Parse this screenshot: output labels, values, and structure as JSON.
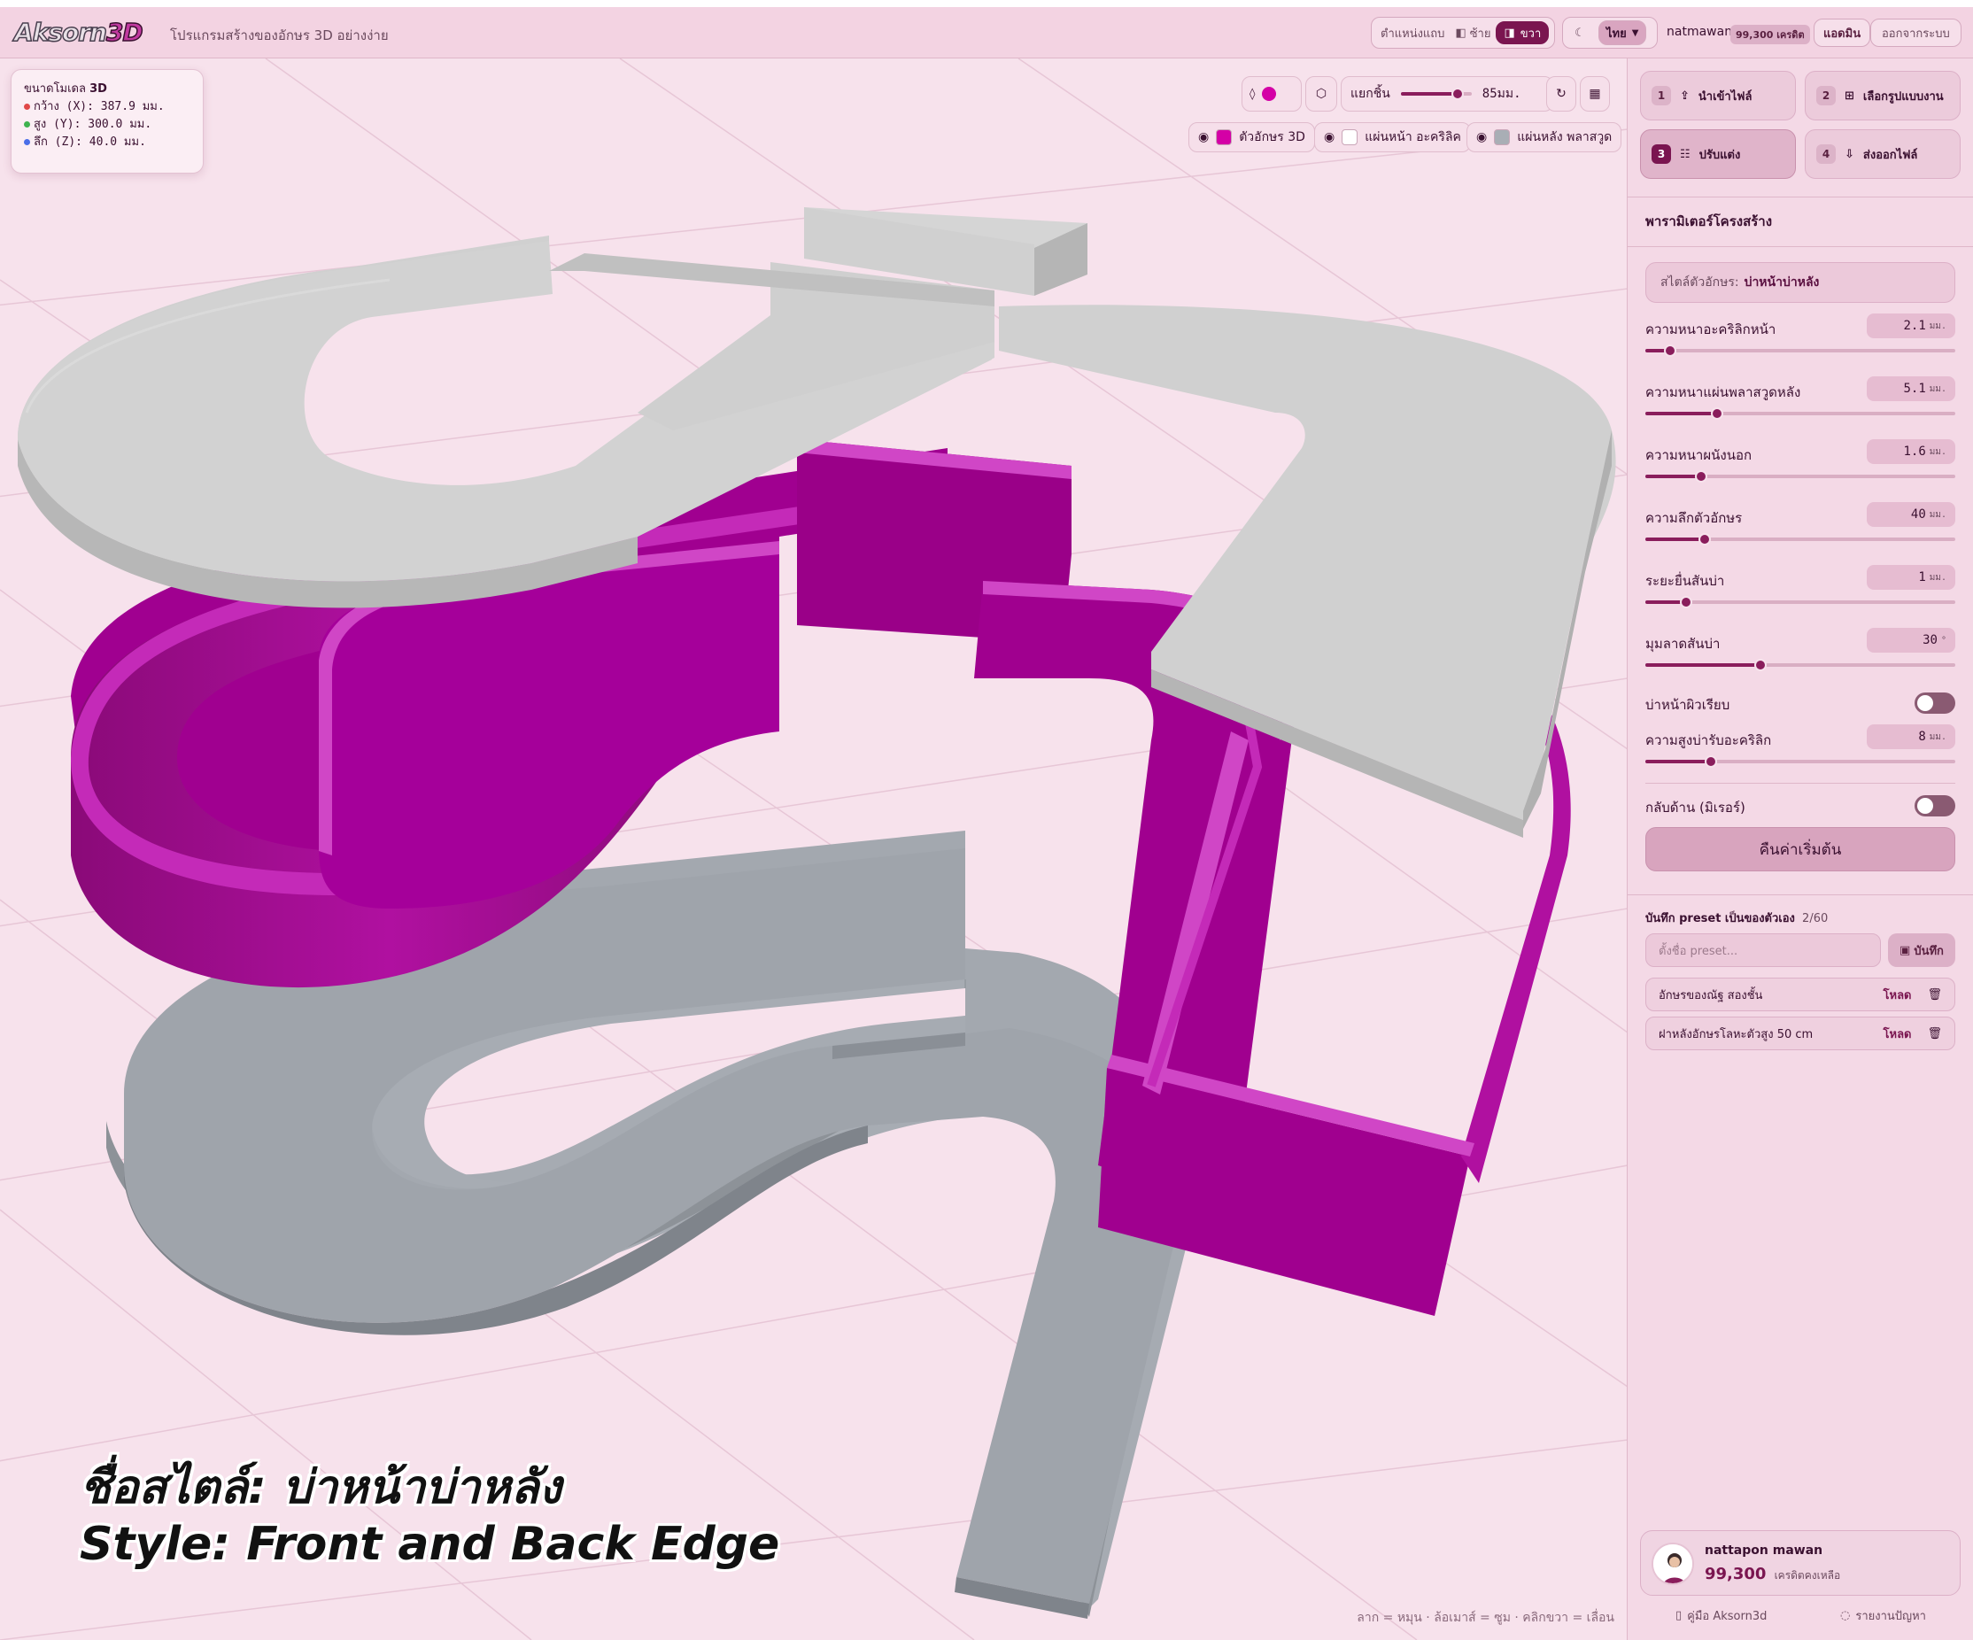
{
  "app": {
    "logo_main": "Aksorn",
    "logo_accent": "3D",
    "tagline": "โปรแกรมสร้างของอักษร 3D อย่างง่าย"
  },
  "header": {
    "position_label": "ตำแหน่งแถบ",
    "left_label": "ซ้าย",
    "right_label": "ขวา",
    "language": "ไทย",
    "username": "natmawan",
    "credits": "99,300 เครดิต",
    "admin_label": "แอดมิน",
    "logout_label": "ออกจากระบบ"
  },
  "viewport": {
    "dims_title": "ขนาดโมเดล",
    "dims_title_accent": "3D",
    "dims": [
      {
        "label": "กว้าง (X): 387.9 มม.",
        "color": "#e04848"
      },
      {
        "label": "สูง (Y): 300.0 มม.",
        "color": "#3fb24f"
      },
      {
        "label": "ลึก (Z): 40.0 มม.",
        "color": "#4a6ee8"
      }
    ],
    "explode_label": "แยกชิ้น",
    "explode_value": "85มม.",
    "explode_fraction": 0.8,
    "layers": [
      {
        "label": "ตัวอักษร 3D",
        "color": "#d400a6"
      },
      {
        "label": "แผ่นหน้า อะคริลิค",
        "color": "#ffffff"
      },
      {
        "label": "แผ่นหลัง พลาสวูด",
        "color": "#a9aeb5"
      }
    ],
    "overlay_line1": "ชื่อสไตล์: บ่าหน้าบ่าหลัง",
    "overlay_line2": "Style: Front and Back Edge",
    "hint": "ลาก = หมุน · ล้อเมาส์ = ซูม · คลิกขวา = เลื่อน"
  },
  "steps": [
    {
      "num": "1",
      "label": "นำเข้าไฟล์"
    },
    {
      "num": "2",
      "label": "เลือกรูปแบบงาน"
    },
    {
      "num": "3",
      "label": "ปรับแต่ง"
    },
    {
      "num": "4",
      "label": "ส่งออกไฟล์"
    }
  ],
  "panel": {
    "title": "พารามิเตอร์โครงสร้าง",
    "style_prefix": "สไตล์ตัวอักษร:",
    "style_name": "บ่าหน้าบ่าหลัง",
    "params": [
      {
        "label": "ความหนาอะคริลิกหน้า",
        "value": "2.1",
        "unit": "มม.",
        "fraction": 0.08
      },
      {
        "label": "ความหนาแผ่นพลาสวูดหลัง",
        "value": "5.1",
        "unit": "มม.",
        "fraction": 0.23
      },
      {
        "label": "ความหนาผนังนอก",
        "value": "1.6",
        "unit": "มม.",
        "fraction": 0.18
      },
      {
        "label": "ความลึกตัวอักษร",
        "value": "40",
        "unit": "มม.",
        "fraction": 0.19
      },
      {
        "label": "ระยะยื่นสันบ่า",
        "value": "1",
        "unit": "มม.",
        "fraction": 0.13
      },
      {
        "label": "มุมลาดสันบ่า",
        "value": "30",
        "unit": "°",
        "fraction": 0.37
      },
      {
        "label": "ความสูงบ่ารับอะคริลิก",
        "value": "8",
        "unit": "มม.",
        "fraction": 0.21
      }
    ],
    "smooth_label": "บ่าหน้าผิวเรียบ",
    "mirror_label": "กลับด้าน (มิเรอร์)",
    "reset_label": "คืนค่าเริ่มต้น",
    "preset_title": "บันทึก preset เป็นของตัวเอง",
    "preset_count": "2/60",
    "preset_placeholder": "ตั้งชื่อ preset...",
    "preset_save": "บันทึก",
    "presets": [
      {
        "name": "อักษรของณัฐ สองชั้น",
        "load": "โหลด"
      },
      {
        "name": "ฝาหลังอักษรโลหะตัวสูง 50 cm",
        "load": "โหลด"
      }
    ]
  },
  "user": {
    "name": "nattapon mawan",
    "credits": "99,300",
    "credits_label": "เครดิตคงเหลือ"
  },
  "footer": {
    "guide": "คู่มือ Aksorn3d",
    "report": "รายงานปัญหา"
  }
}
